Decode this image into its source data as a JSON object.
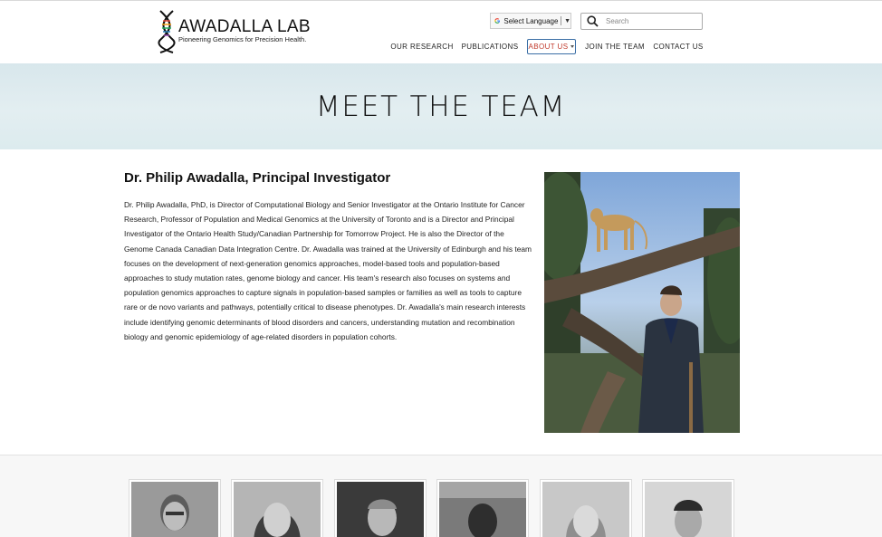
{
  "brand": {
    "name": "AWADALLA LAB",
    "tagline": "Pioneering Genomics for Precision Health."
  },
  "language": {
    "label": "Select Language",
    "arrow": "▼"
  },
  "search": {
    "placeholder": "Search"
  },
  "nav": {
    "items": [
      {
        "label": "OUR RESEARCH",
        "active": false
      },
      {
        "label": "PUBLICATIONS",
        "active": false
      },
      {
        "label": "ABOUT US",
        "active": true,
        "has_dropdown": true
      },
      {
        "label": "JOIN THE TEAM",
        "active": false
      },
      {
        "label": "CONTACT US",
        "active": false
      }
    ]
  },
  "banner": {
    "title": "MEET THE TEAM"
  },
  "profile": {
    "name": "Dr. Philip Awadalla, Principal Investigator",
    "bio": "Dr. Philip Awadalla, PhD, is Director of Computational Biology and Senior Investigator at the Ontario Institute for Cancer Research, Professor of Population and Medical Genomics at the University of Toronto and is a Director and Principal Investigator of the Ontario Health Study/Canadian Partnership for Tomorrow Project. He is also the Director of the Genome Canada Canadian Data Integration Centre. Dr. Awadalla was trained at the University of Edinburgh and his team focuses on the development of next-generation genomics approaches, model-based tools and population-based approaches to study mutation rates, genome biology and cancer. His team's research also focuses on systems and population genomics approaches to capture signals in population-based samples or families as well as tools to capture rare or de novo variants and pathways, potentially critical to disease phenotypes. Dr. Awadalla's main research interests include identifying genomic determinants of blood disorders and cancers, understanding mutation and recombination biology and genomic epidemiology of age-related disorders in population cohorts."
  },
  "colors": {
    "active_nav_text": "#c0392b",
    "active_nav_border": "#3a6ea5",
    "banner_bg": "#dde9ee"
  },
  "team_photos_count": 6
}
